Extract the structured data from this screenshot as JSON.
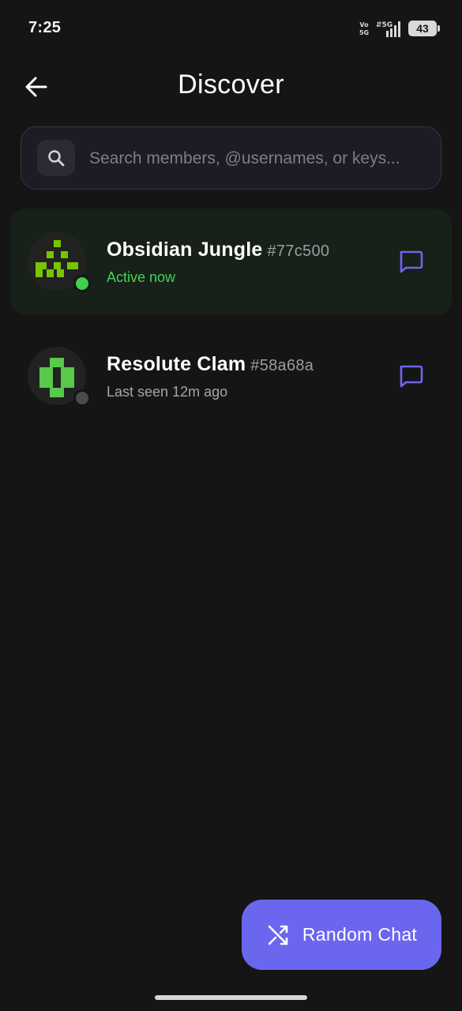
{
  "status_bar": {
    "time": "7:25",
    "volte_label": "Vo 5G",
    "network_label": "5G",
    "battery_level": "43"
  },
  "header": {
    "title": "Discover",
    "back_icon": "arrow-left-icon"
  },
  "search": {
    "placeholder": "Search members, @usernames, or keys...",
    "value": "",
    "icon": "search-icon"
  },
  "members": [
    {
      "name": "Obsidian Jungle",
      "tag": "#77c500",
      "status": "Active now",
      "online": true,
      "avatar_color": "#77c500",
      "action_icon": "message-icon"
    },
    {
      "name": "Resolute Clam",
      "tag": "#58a68a",
      "status": "Last seen 12m ago",
      "online": false,
      "avatar_color": "#58c94a",
      "action_icon": "message-icon"
    }
  ],
  "fab": {
    "label": "Random Chat",
    "icon": "shuffle-icon"
  },
  "colors": {
    "background": "#151515",
    "accent": "#6b66ee",
    "online": "#3fd04e",
    "active_row": "#172019"
  }
}
